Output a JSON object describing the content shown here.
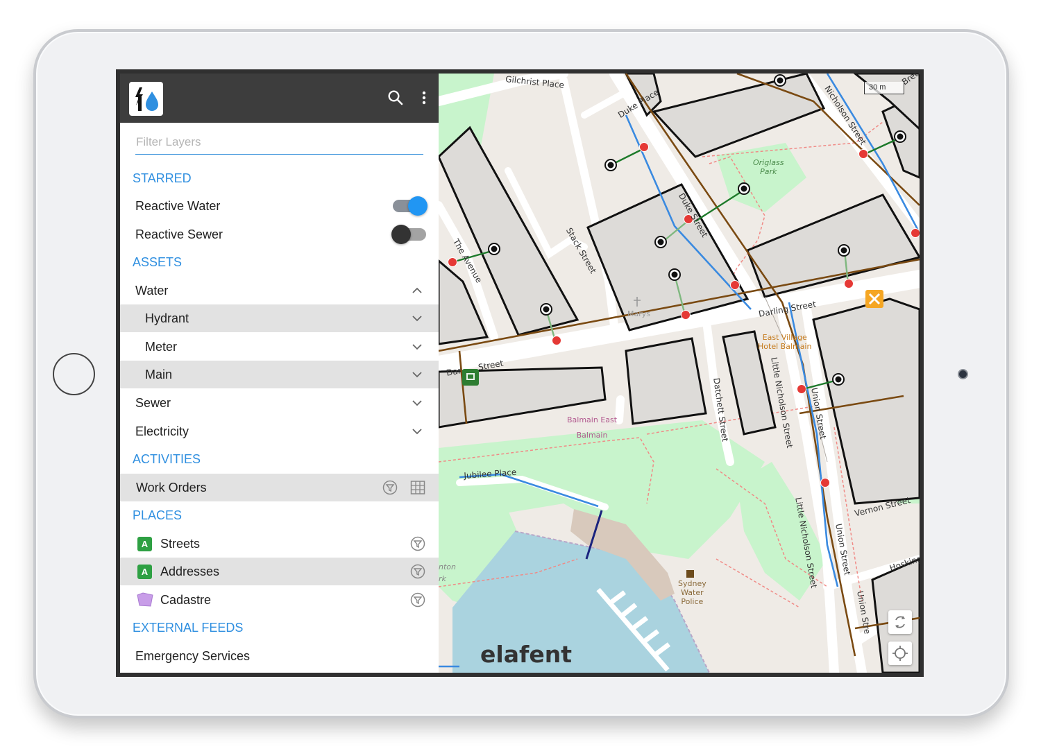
{
  "panel": {
    "filter_placeholder": "Filter Layers",
    "sections": {
      "starred": "STARRED",
      "assets": "ASSETS",
      "activities": "ACTIVITIES",
      "places": "PLACES",
      "external_feeds": "EXTERNAL FEEDS"
    },
    "starred_items": [
      {
        "label": "Reactive Water",
        "toggle": "on"
      },
      {
        "label": "Reactive Sewer",
        "toggle": "off"
      }
    ],
    "assets": {
      "water": "Water",
      "water_children": [
        "Hydrant",
        "Meter",
        "Main"
      ],
      "sewer": "Sewer",
      "electricity": "Electricity"
    },
    "activities": {
      "work_orders": "Work Orders"
    },
    "places": {
      "streets": "Streets",
      "addresses": "Addresses",
      "cadastre": "Cadastre",
      "badge": "A"
    },
    "external": {
      "emergency": "Emergency Services"
    }
  },
  "map": {
    "scale_label": "30 m",
    "brand": "elafent",
    "streets": {
      "gilchrist": "Gilchrist Place",
      "duke_place": "Duke Place",
      "nicholson": "Nicholson Street",
      "duke_street": "Duke Street",
      "stack": "Stack Street",
      "avenue": "The Avenue",
      "darling": "Darling Street",
      "darling_left": "Dar",
      "darling_left2": "Street",
      "little_nicholson": "Little Nicholson Street",
      "little_nicholson2": "Little Nicholson Street",
      "union": "Union Street",
      "union2": "Union Street",
      "union3": "Union Stre",
      "datchett": "Datchett Street",
      "jubilee": "Jubilee Place",
      "vernon": "Vernon Street",
      "hosking": "Hosking",
      "brett": "Brett"
    },
    "pois": {
      "origlass1": "Origlass",
      "origlass2": "Park",
      "balmain_east": "Balmain East",
      "balmain": "Balmain",
      "east_village1": "East Village",
      "east_village2": "Hotel Balmain",
      "police1": "Sydney",
      "police2": "Water",
      "police3": "Police",
      "marys": "Marys",
      "nton": "nton",
      "rk": "rk"
    },
    "colors": {
      "accent": "#2f8fe0",
      "water_main": "#3a8ae0",
      "sewer_main": "#7a4a12",
      "service_line": "#1d7a2a",
      "hydrant_red": "#e53935",
      "park_green": "#c8f4cc",
      "harbour": "#aad3df"
    }
  }
}
